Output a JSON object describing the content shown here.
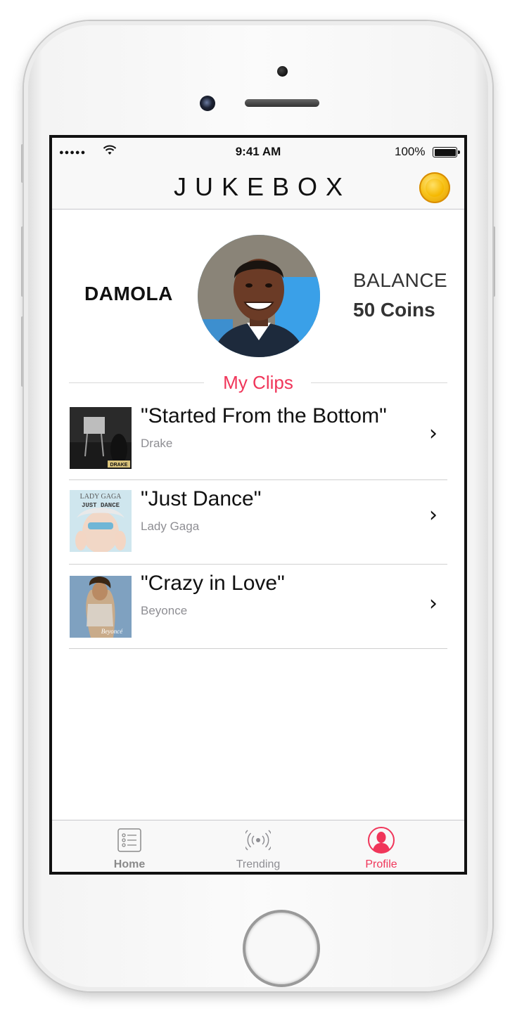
{
  "status_bar": {
    "time": "9:41 AM",
    "battery": "100%"
  },
  "header": {
    "title": "JUKEBOX"
  },
  "profile": {
    "name": "DAMOLA",
    "balance_label": "BALANCE",
    "balance_value": "50 Coins"
  },
  "section": {
    "title": "My Clips"
  },
  "clips": [
    {
      "title": "\"Started From the Bottom\"",
      "artist": "Drake",
      "art_text": "DRAKE"
    },
    {
      "title": "\"Just Dance\"",
      "artist": "Lady Gaga",
      "art_text_top": "LADY GAGA",
      "art_text_sub": "JUST DANCE"
    },
    {
      "title": "\"Crazy in Love\"",
      "artist": "Beyonce",
      "art_text": "Beyoncé"
    }
  ],
  "tabs": [
    {
      "label": "Home",
      "icon": "list-icon"
    },
    {
      "label": "Trending",
      "icon": "broadcast-icon"
    },
    {
      "label": "Profile",
      "icon": "person-icon",
      "active": true
    }
  ],
  "colors": {
    "accent": "#f0365a",
    "coin": "#f7c21a"
  }
}
